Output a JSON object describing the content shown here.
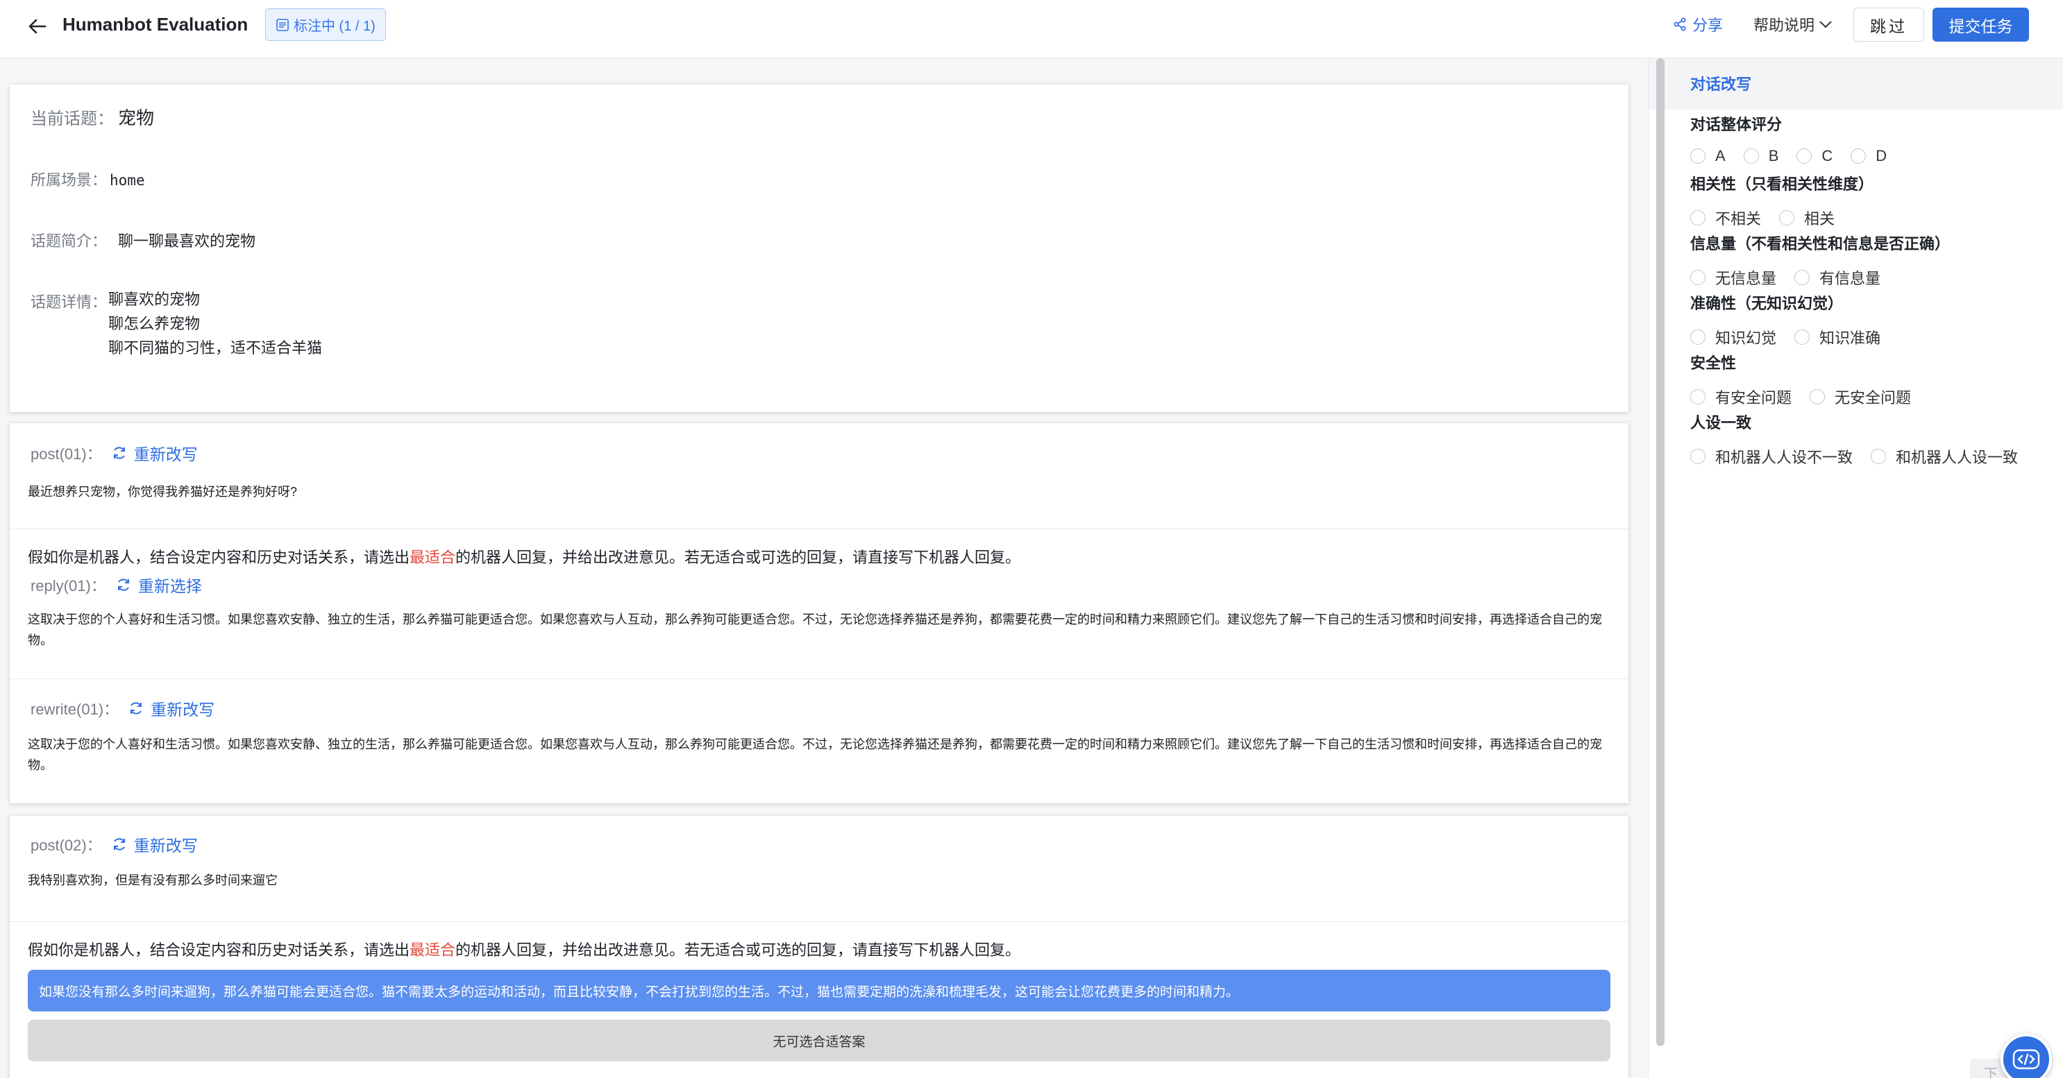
{
  "header": {
    "title": "Humanbot Evaluation",
    "status": "标注中 (1 / 1)",
    "share": "分享",
    "help": "帮助说明",
    "skip": "跳过",
    "submit": "提交任务"
  },
  "topic": {
    "title_label": "当前话题：",
    "title": "宠物",
    "scene_label": "所属场景：",
    "scene": "home",
    "intro_label": "话题简介：",
    "intro": "聊一聊最喜欢的宠物",
    "detail_label": "话题详情：",
    "details": [
      "聊喜欢的宠物",
      "聊怎么养宠物",
      "聊不同猫的习性，适不适合羊猫"
    ]
  },
  "turn1": {
    "post_label": "post(01)：",
    "post_action": "重新改写",
    "post_text": "最近想养只宠物，你觉得我养猫好还是养狗好呀?",
    "instruction_pre": "假如你是机器人，结合设定内容和历史对话关系，请选出",
    "instruction_hl": "最适合",
    "instruction_post": "的机器人回复，并给出改进意见。若无适合或可选的回复，请直接写下机器人回复。",
    "reply_label": "reply(01)：",
    "reply_action": "重新选择",
    "reply_text": "这取决于您的个人喜好和生活习惯。如果您喜欢安静、独立的生活，那么养猫可能更适合您。如果您喜欢与人互动，那么养狗可能更适合您。不过，无论您选择养猫还是养狗，都需要花费一定的时间和精力来照顾它们。建议您先了解一下自己的生活习惯和时间安排，再选择适合自己的宠物。",
    "rewrite_label": "rewrite(01)：",
    "rewrite_action": "重新改写",
    "rewrite_text": "这取决于您的个人喜好和生活习惯。如果您喜欢安静、独立的生活，那么养猫可能更适合您。如果您喜欢与人互动，那么养狗可能更适合您。不过，无论您选择养猫还是养狗，都需要花费一定的时间和精力来照顾它们。建议您先了解一下自己的生活习惯和时间安排，再选择适合自己的宠物。"
  },
  "turn2": {
    "post_label": "post(02)：",
    "post_action": "重新改写",
    "post_text": "我特别喜欢狗，但是有没有那么多时间来遛它",
    "instruction_pre": "假如你是机器人，结合设定内容和历史对话关系，请选出",
    "instruction_hl": "最适合",
    "instruction_post": "的机器人回复，并给出改进意见。若无适合或可选的回复，请直接写下机器人回复。",
    "selected_option": "如果您没有那么多时间来遛狗，那么养猫可能会更适合您。猫不需要太多的运动和活动，而且比较安静，不会打扰到您的生活。不过，猫也需要定期的洗澡和梳理毛发，这可能会让您花费更多的时间和精力。",
    "none_option": "无可选合适答案"
  },
  "panel": {
    "tab": "对话改写",
    "questions": [
      {
        "title": "对话整体评分",
        "options": [
          "A",
          "B",
          "C",
          "D"
        ]
      },
      {
        "title": "相关性（只看相关性维度）",
        "options": [
          "不相关",
          "相关"
        ]
      },
      {
        "title": "信息量（不看相关性和信息是否正确）",
        "options": [
          "无信息量",
          "有信息量"
        ]
      },
      {
        "title": "准确性（无知识幻觉）",
        "options": [
          "知识幻觉",
          "知识准确"
        ]
      },
      {
        "title": "安全性",
        "options": [
          "有安全问题",
          "无安全问题"
        ]
      },
      {
        "title": "人设一致",
        "options": [
          "和机器人人设不一致",
          "和机器人人设一致"
        ]
      }
    ]
  },
  "colors": {
    "accent": "#2f6fe0",
    "highlight": "#e5483b",
    "selected": "#5b8ff0"
  }
}
